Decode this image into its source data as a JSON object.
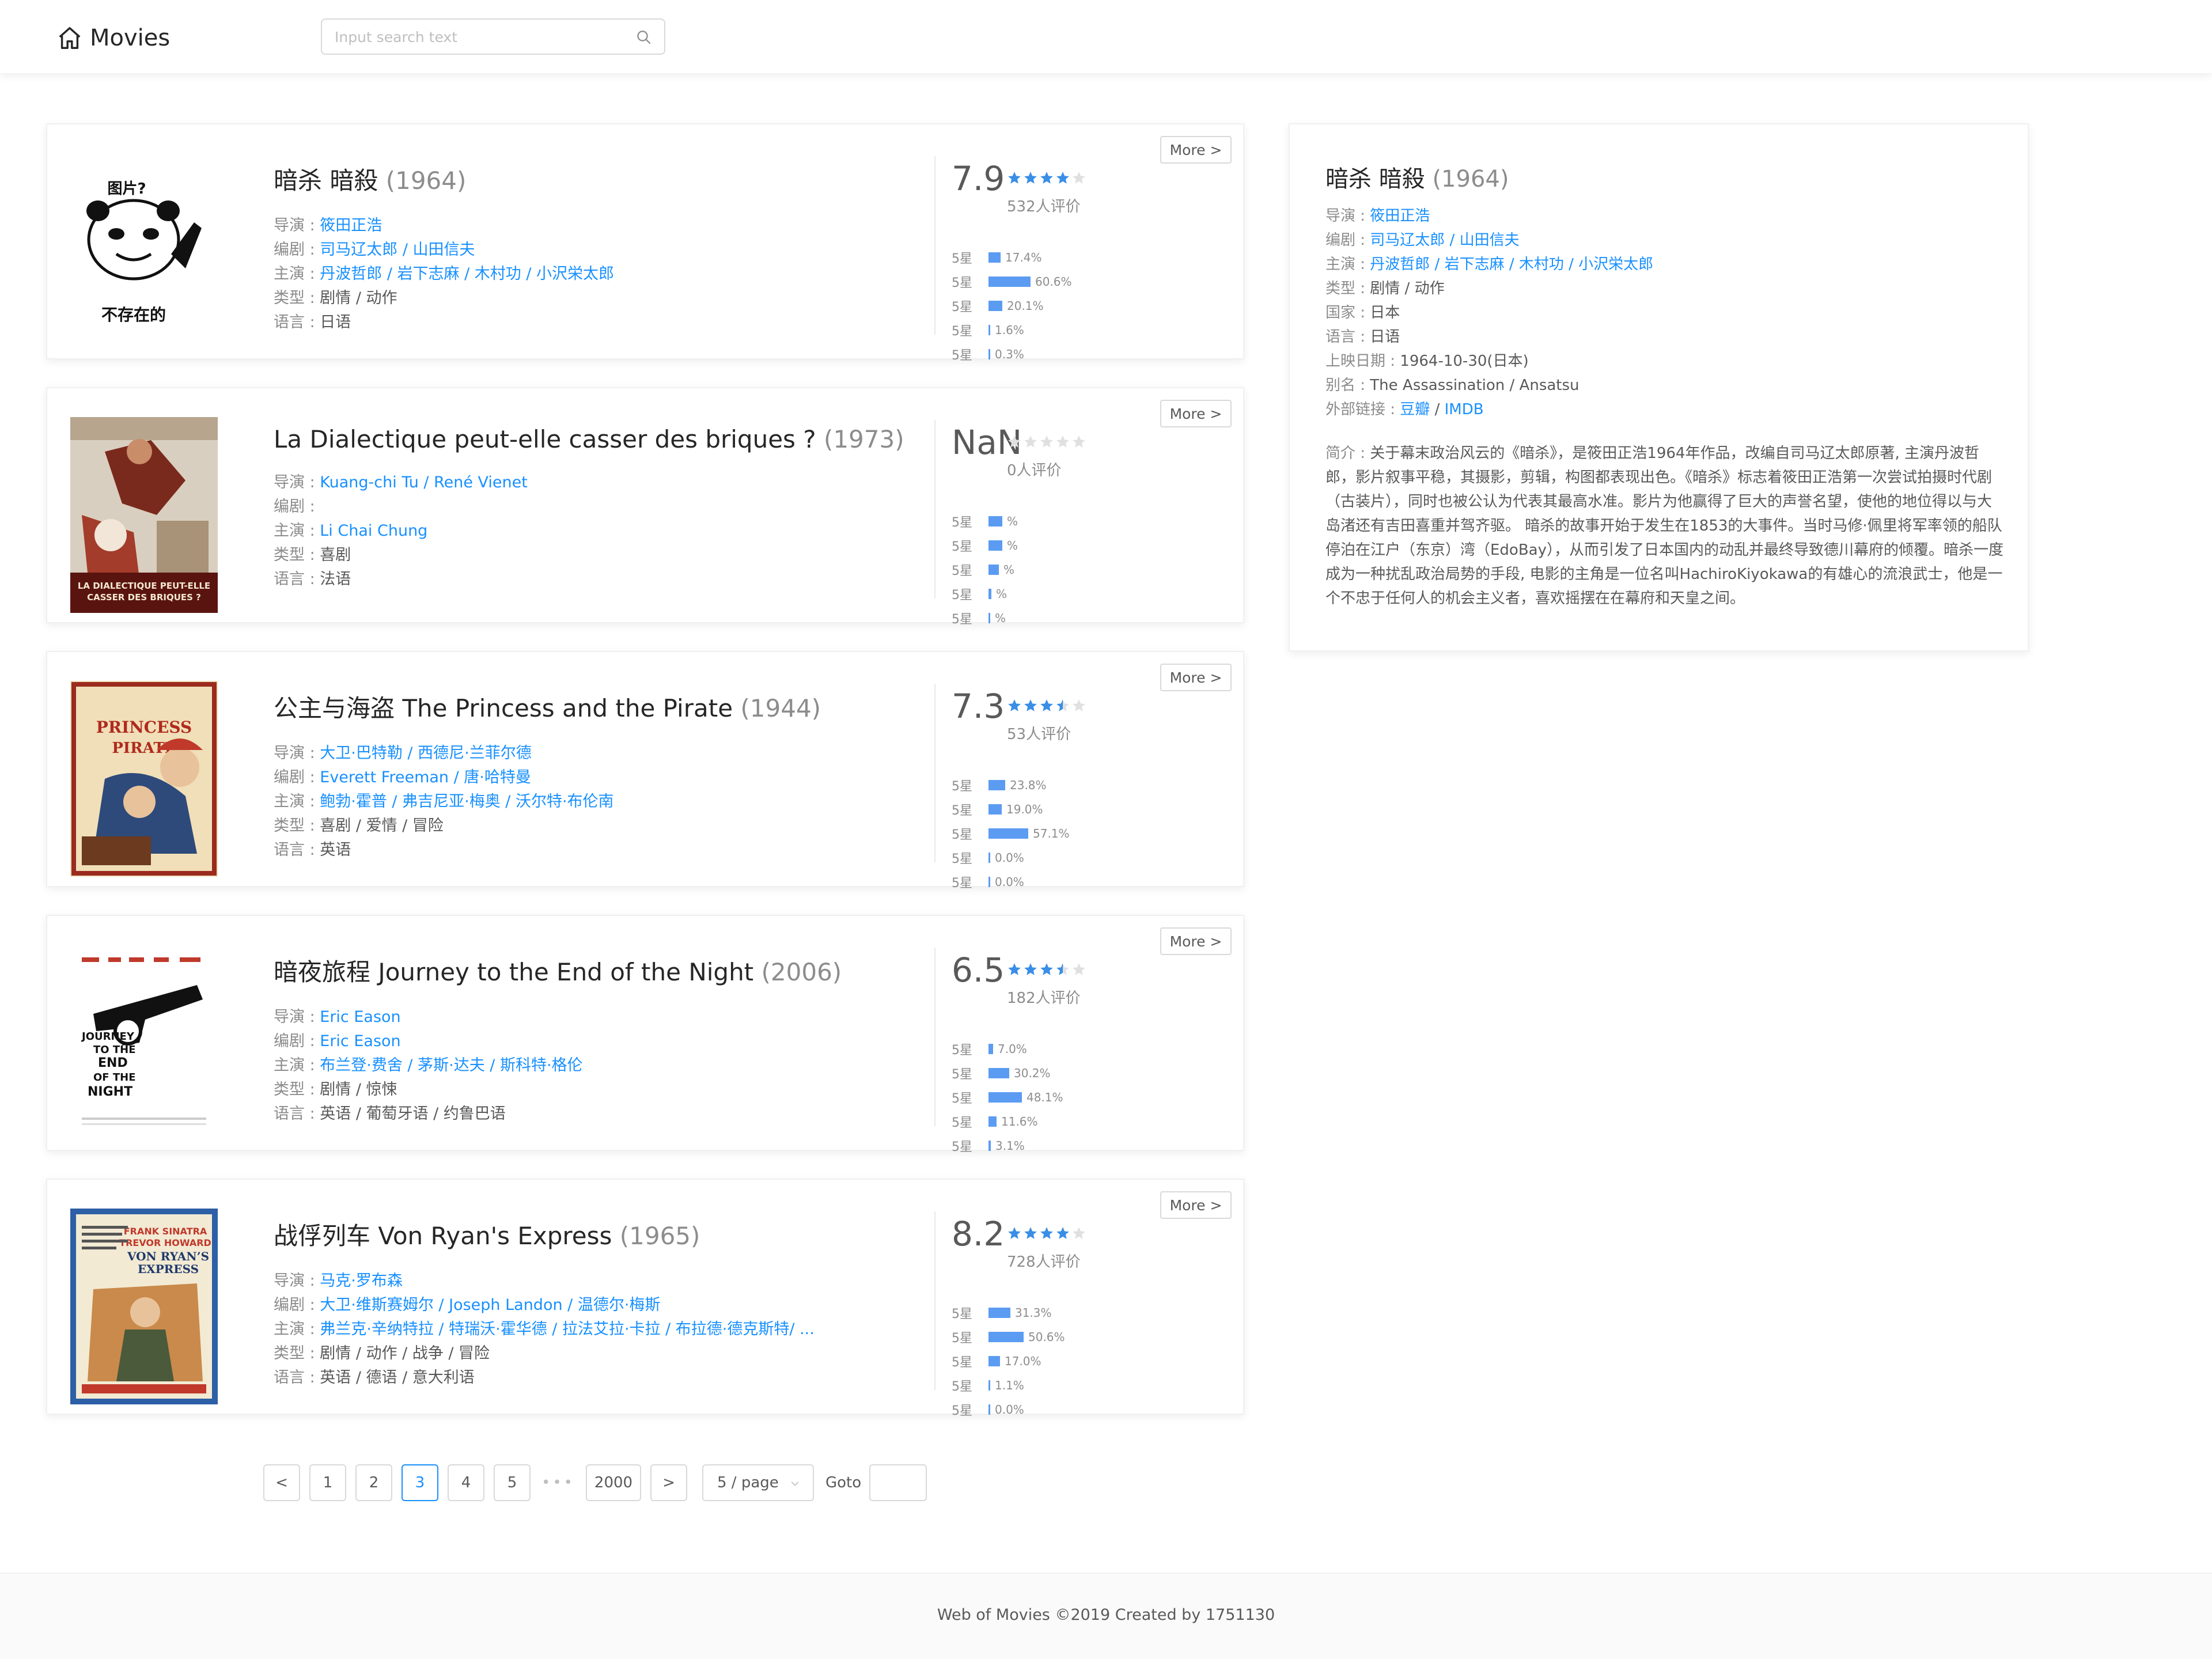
{
  "header": {
    "app_title": "Movies",
    "search_placeholder": "Input search text"
  },
  "ui": {
    "more_label": "More >",
    "labels": {
      "director": "导演 : ",
      "writer": "编剧 : ",
      "actors": "主演 : ",
      "genre": "类型 : ",
      "language": "语言 : ",
      "country": "国家 : ",
      "release": "上映日期 : ",
      "aka": "别名 : ",
      "links": "外部链接 : ",
      "intro": "简介 : "
    },
    "star_label": "5星"
  },
  "movies": [
    {
      "title": "暗杀 暗殺",
      "year": "(1964)",
      "poster_text_top": "图片?",
      "poster_text_bottom": "不存在的",
      "director": "筱田正浩",
      "writer": "司马辽太郎 / 山田信夫",
      "actors": "丹波哲郎 / 岩下志麻 / 木村功 / 小沢栄太郎",
      "genre": "剧情 / 动作",
      "language": "日语",
      "score": "7.9",
      "stars": 4,
      "votes": "532人评价",
      "dist": [
        17.4,
        60.6,
        20.1,
        1.6,
        0.3
      ],
      "dist_labels": [
        "17.4%",
        "60.6%",
        "20.1%",
        "1.6%",
        "0.3%"
      ]
    },
    {
      "title": "La Dialectique peut-elle casser des briques ?",
      "year": "(1973)",
      "poster_caption": "LA DIALECTIQUE PEUT-ELLE CASSER DES BRIQUES ?",
      "director": "Kuang-chi Tu / René Vienet",
      "writer": "",
      "actors": "Li Chai Chung",
      "genre": "喜剧",
      "language": "法语",
      "score": "NaN",
      "stars": 0,
      "votes": "0人评价",
      "dist": [
        20,
        20,
        15,
        4,
        1
      ],
      "dist_labels": [
        "%",
        "%",
        "%",
        "%",
        "%"
      ]
    },
    {
      "title": "公主与海盗 The Princess and the Pirate",
      "year": "(1944)",
      "poster_caption": "THE PRINCESS AND THE PIRATE",
      "director": "大卫·巴特勒 / 西德尼·兰菲尔德",
      "writer": "Everett Freeman / 唐·哈特曼",
      "actors": "鲍勃·霍普 / 弗吉尼亚·梅奥 / 沃尔特·布伦南",
      "genre": "喜剧 / 爱情 / 冒险",
      "language": "英语",
      "score": "7.3",
      "stars": 3.5,
      "votes": "53人评价",
      "dist": [
        23.8,
        19.0,
        57.1,
        0.0,
        0.0
      ],
      "dist_labels": [
        "23.8%",
        "19.0%",
        "57.1%",
        "0.0%",
        "0.0%"
      ]
    },
    {
      "title": "暗夜旅程 Journey to the End of the Night",
      "year": "(2006)",
      "poster_caption": "JOURNEY TO THE END OF THE NIGHT",
      "director": "Eric Eason",
      "writer": "Eric Eason",
      "actors": "布兰登·费舍 / 茅斯·达夫 / 斯科特·格伦",
      "genre": "剧情 / 惊悚",
      "language": "英语 / 葡萄牙语 / 约鲁巴语",
      "score": "6.5",
      "stars": 3.5,
      "votes": "182人评价",
      "dist": [
        7.0,
        30.2,
        48.1,
        11.6,
        3.1
      ],
      "dist_labels": [
        "7.0%",
        "30.2%",
        "48.1%",
        "11.6%",
        "3.1%"
      ]
    },
    {
      "title": "战俘列车 Von Ryan's Express",
      "year": "(1965)",
      "poster_caption": "FRANK SINATRA TREVOR HOWARD VON RYAN'S EXPRESS",
      "director": "马克·罗布森",
      "writer": "大卫·维斯赛姆尔 / Joseph Landon / 温德尔·梅斯",
      "actors": "弗兰克·辛纳特拉 / 特瑞沃·霍华德 / 拉法艾拉·卡拉 / 布拉德·德克斯特/ ...",
      "genre": "剧情 / 动作 / 战争 / 冒险",
      "language": "英语 / 德语 / 意大利语",
      "score": "8.2",
      "stars": 4,
      "votes": "728人评价",
      "dist": [
        31.3,
        50.6,
        17.0,
        1.1,
        0.0
      ],
      "dist_labels": [
        "31.3%",
        "50.6%",
        "17.0%",
        "1.1%",
        "0.0%"
      ]
    }
  ],
  "detail": {
    "title": "暗杀 暗殺",
    "year": "(1964)",
    "director": "筱田正浩",
    "writer": "司马辽太郎 / 山田信夫",
    "actors": "丹波哲郎 / 岩下志麻 / 木村功 / 小沢栄太郎",
    "genre": "剧情 / 动作",
    "country": "日本",
    "language": "日语",
    "release": "1964-10-30(日本)",
    "aka": "The Assassination / Ansatsu",
    "link_douban": "豆瓣",
    "link_imdb": "IMDB",
    "intro": "关于幕末政治风云的《暗杀》，是筱田正浩1964年作品，改编自司马辽太郎原著, 主演丹波哲郎，影片叙事平稳，其摄影，剪辑，构图都表现出色。《暗杀》标志着筱田正浩第一次尝试拍摄时代剧（古装片），同时也被公认为代表其最高水准。影片为他赢得了巨大的声誉名望，使他的地位得以与大岛渚还有吉田喜重并驾齐驱。 暗杀的故事开始于发生在1853的大事件。当时马修·佩里将军率领的船队停泊在江户（东京）湾（EdoBay），从而引发了日本国内的动乱并最终导致德川幕府的倾覆。暗杀一度成为一种扰乱政治局势的手段, 电影的主角是一位名叫HachiroKiyokawa的有雄心的流浪武士，他是一个不忠于任何人的机会主义者，喜欢摇摆在在幕府和天皇之间。"
  },
  "pagination": {
    "prev": "<",
    "pages": [
      "1",
      "2",
      "3",
      "4",
      "5"
    ],
    "current": "3",
    "ellipsis": "•••",
    "last": "2000",
    "next": ">",
    "page_size": "5 / page",
    "goto_label": "Goto"
  },
  "footer": {
    "text": "Web of Movies ©2019 Created by 1751130"
  },
  "colors": {
    "accent": "#1890ff",
    "bar": "#5b9cf2",
    "star_filled": "#3a8ee6",
    "star_empty": "#e0e0e0"
  }
}
